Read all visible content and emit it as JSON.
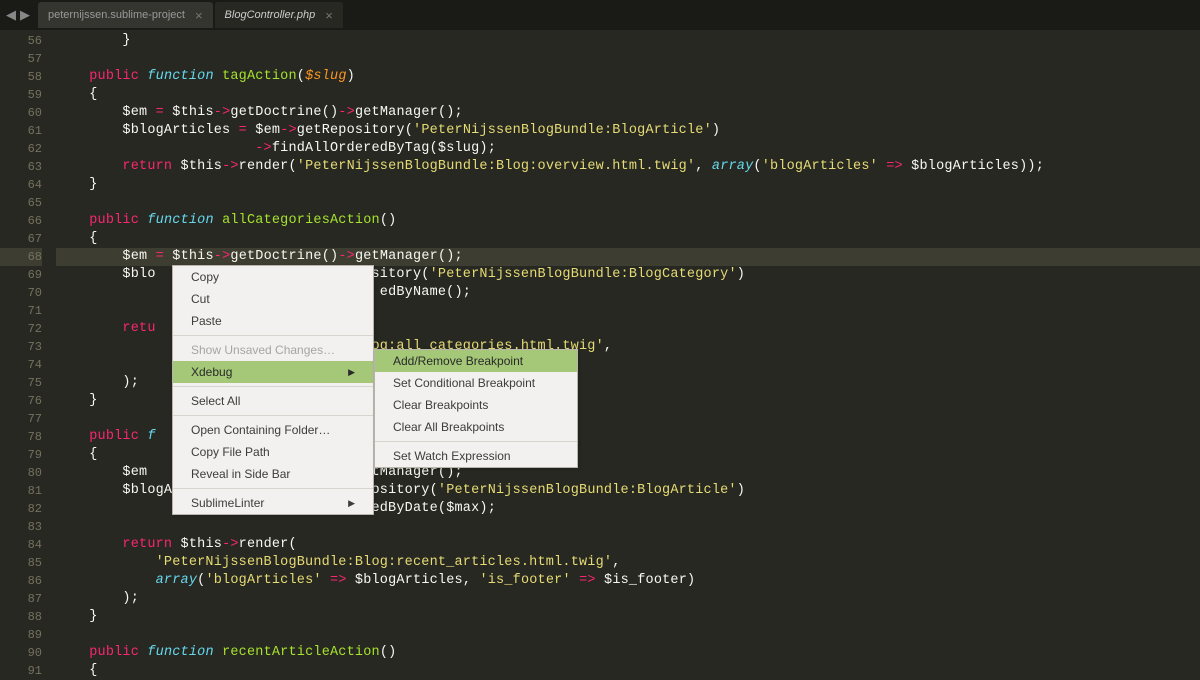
{
  "tabs": [
    {
      "label": "peternijssen.sublime-project",
      "active": false
    },
    {
      "label": "BlogController.php",
      "active": true
    }
  ],
  "lines": {
    "start": 56,
    "end": 91,
    "breakpoint_line": 69,
    "highlight_line": 68
  },
  "code": {
    "l56": "        }",
    "l58_public": "public",
    "l58_function": "function",
    "l58_name": "tagAction",
    "l58_param": "$slug",
    "l60_em": "$em",
    "l60_this": "$this",
    "l60_getdoc": "getDoctrine",
    "l60_getmgr": "getManager",
    "l61_ba": "$blogArticles",
    "l61_em": "$em",
    "l61_getrepo": "getRepository",
    "l61_str": "'PeterNijssenBlogBundle:BlogArticle'",
    "l62_fn": "findAllOrderedByTag",
    "l62_param": "$slug",
    "l63_return": "return",
    "l63_this": "$this",
    "l63_render": "render",
    "l63_str": "'PeterNijssenBlogBundle:Blog:overview.html.twig'",
    "l63_array": "array",
    "l63_key": "'blogArticles'",
    "l63_val": "$blogArticles",
    "l66_name": "allCategoriesAction",
    "l68_em": "$em",
    "l68_this": "$this",
    "l68_getdoc": "getDoctrine",
    "l68_getmgr": "getManager",
    "l69_blo": "$blo",
    "l69_repo": "epository(",
    "l69_str": "'PeterNijssenBlogBundle:BlogCategory'",
    "l70_suffix": "edByName();",
    "l72_return": "retu",
    "l73_str": ":Blog:all_categories.html.twig'",
    "l75_close": ");",
    "l78_public": "public",
    "l78_f": "f",
    "l80_em": "$em",
    "l80_getmgr": "getManager",
    "l81_ba": "$blogA",
    "l81_getrepo": "getRepository(",
    "l81_str": "'PeterNijssenBlogBundle:BlogArticle'",
    "l82_fn": "findAllOrderedByDate",
    "l82_param": "$max",
    "l84_return": "return",
    "l84_this": "$this",
    "l84_render": "render",
    "l85_str": "'PeterNijssenBlogBundle:Blog:recent_articles.html.twig'",
    "l86_array": "array",
    "l86_key1": "'blogArticles'",
    "l86_val1": "$blogArticles",
    "l86_key2": "'is_footer'",
    "l86_val2": "$is_footer",
    "l90_name": "recentArticleAction"
  },
  "menu": {
    "copy": "Copy",
    "cut": "Cut",
    "paste": "Paste",
    "unsaved": "Show Unsaved Changes…",
    "xdebug": "Xdebug",
    "selectall": "Select All",
    "openfolder": "Open Containing Folder…",
    "copypath": "Copy File Path",
    "reveal": "Reveal in Side Bar",
    "linter": "SublimeLinter"
  },
  "submenu": {
    "addremove": "Add/Remove Breakpoint",
    "setcond": "Set Conditional Breakpoint",
    "clear": "Clear Breakpoints",
    "clearall": "Clear All Breakpoints",
    "watch": "Set Watch Expression"
  }
}
